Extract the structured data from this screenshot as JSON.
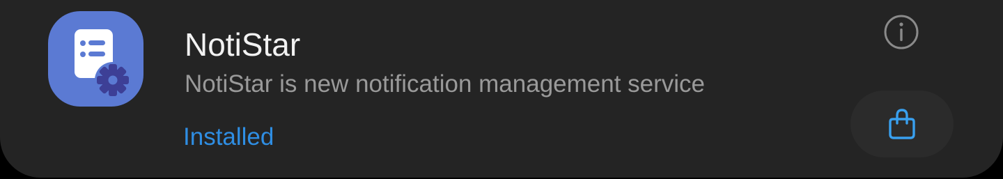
{
  "app": {
    "name": "NotiStar",
    "description": "NotiStar is new notification management service",
    "status": "Installed",
    "icon": "notistar-app-icon"
  },
  "actions": {
    "info_icon": "info-icon",
    "open_icon": "shopping-bag-icon"
  },
  "colors": {
    "card_background": "#242424",
    "icon_background": "#5b7ad3",
    "status_text": "#2f8ee3",
    "title_text": "#f2f2f2",
    "description_text": "#9a9a9a"
  }
}
